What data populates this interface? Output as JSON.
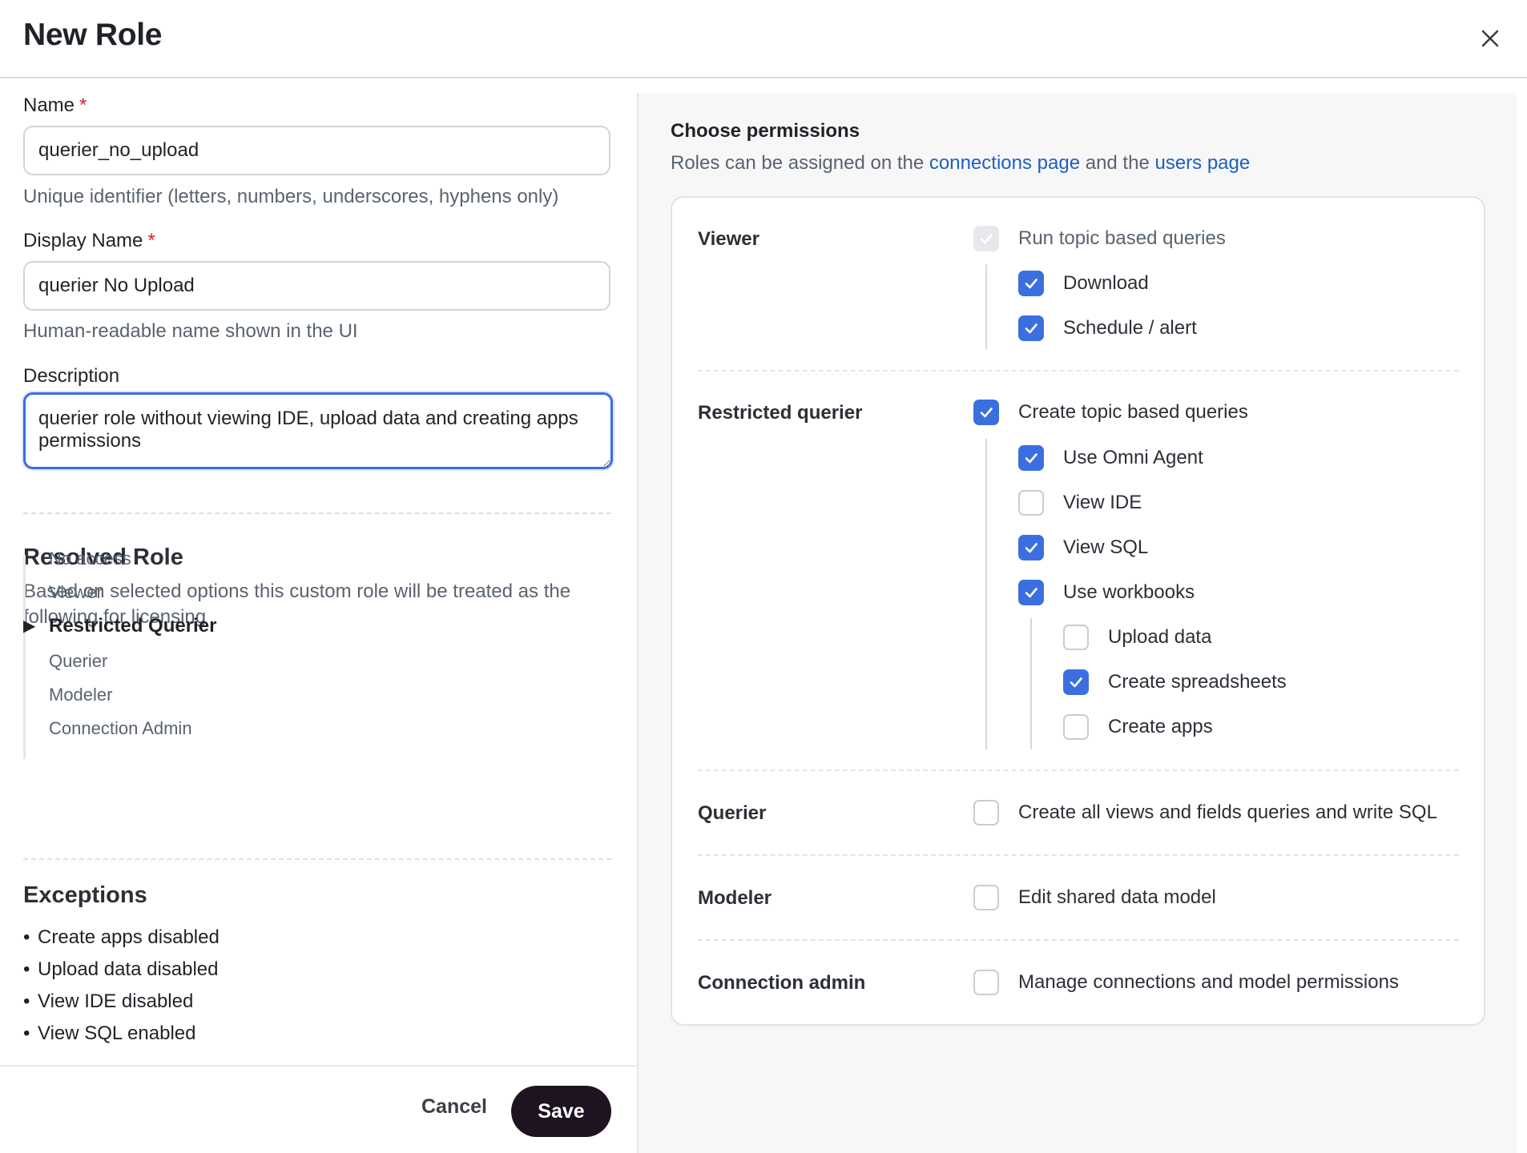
{
  "header": {
    "title": "New Role"
  },
  "form": {
    "name_label": "Name",
    "required_mark": "*",
    "name_value": "querier_no_upload",
    "name_hint": "Unique identifier (letters, numbers, underscores, hyphens only)",
    "display_label": "Display Name",
    "display_value": "querier No Upload",
    "display_hint": "Human-readable name shown in the UI",
    "description_label": "Description",
    "description_value": "querier role without viewing IDE, upload data and creating apps permissions"
  },
  "resolved": {
    "title": "Resolved Role",
    "description": "Based on selected options this custom role will be treated as the following for licensing",
    "roles": [
      "No access",
      "Viewer",
      "Restricted Querier",
      "Querier",
      "Modeler",
      "Connection Admin"
    ],
    "active_index": 2
  },
  "exceptions": {
    "title": "Exceptions",
    "bullet": "•",
    "items": [
      "Create apps disabled",
      "Upload data disabled",
      "View IDE disabled",
      "View SQL enabled"
    ]
  },
  "footer": {
    "cancel_label": "Cancel",
    "save_label": "Save"
  },
  "permissions": {
    "title": "Choose permissions",
    "subtitle_prefix": "Roles can be assigned on the ",
    "link1": "connections page",
    "subtitle_mid": " and the ",
    "link2": "users page",
    "groups": {
      "viewer": {
        "label": "Viewer",
        "items": [
          {
            "label": "Run topic based queries",
            "checked": true,
            "disabled": true
          },
          {
            "label": "Download",
            "checked": true
          },
          {
            "label": "Schedule / alert",
            "checked": true
          }
        ]
      },
      "restricted": {
        "label": "Restricted querier",
        "items": [
          {
            "label": "Create topic based queries",
            "checked": true
          },
          {
            "label": "Use Omni Agent",
            "checked": true
          },
          {
            "label": "View IDE",
            "checked": false
          },
          {
            "label": "View SQL",
            "checked": true
          },
          {
            "label": "Use workbooks",
            "checked": true
          },
          {
            "label": "Upload data",
            "checked": false
          },
          {
            "label": "Create spreadsheets",
            "checked": true
          },
          {
            "label": "Create apps",
            "checked": false
          }
        ]
      },
      "querier": {
        "label": "Querier",
        "items": [
          {
            "label": "Create all views and fields queries and write SQL",
            "checked": false
          }
        ]
      },
      "modeler": {
        "label": "Modeler",
        "items": [
          {
            "label": "Edit shared data model",
            "checked": false
          }
        ]
      },
      "connection_admin": {
        "label": "Connection admin",
        "items": [
          {
            "label": "Manage connections and model permissions",
            "checked": false
          }
        ]
      }
    }
  },
  "colors": {
    "accent": "#3b6fe0",
    "link": "#1f5fbf",
    "required": "#d1242f",
    "save_bg": "#1e1320"
  }
}
